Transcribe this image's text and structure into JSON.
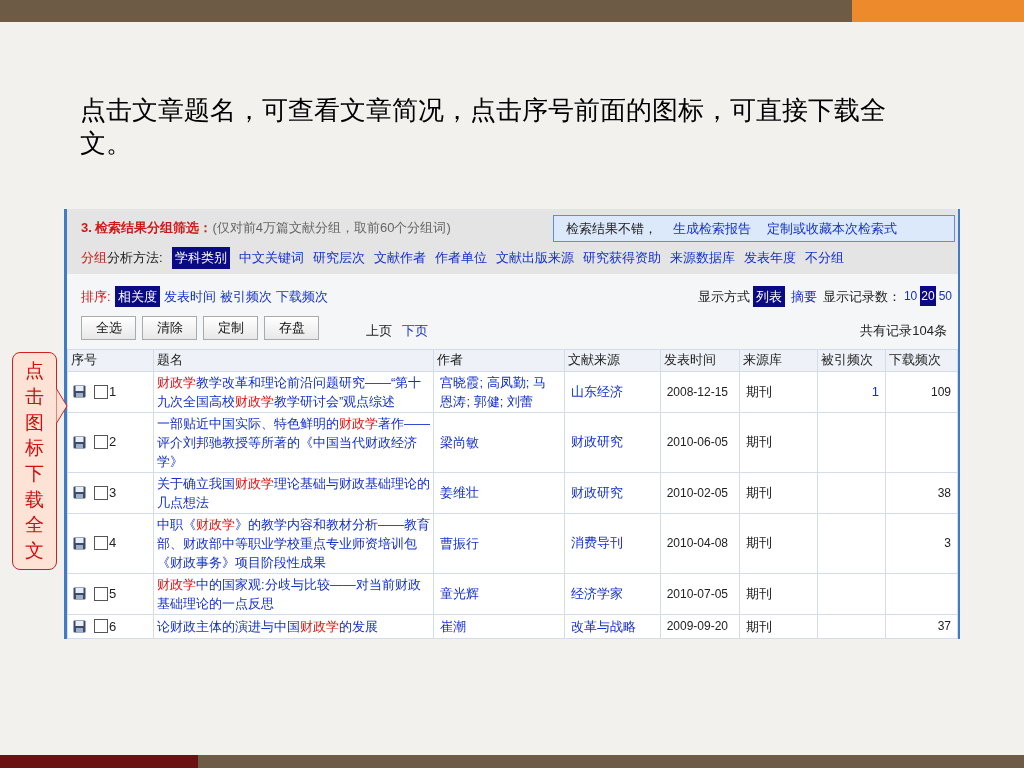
{
  "slide": {
    "text": "点击文章题名，可查看文章简况，点击序号前面的图标，可直接下载全文。",
    "callout": "点击图标下载全文"
  },
  "filter": {
    "heading": "3. 检索结果分组筛选：",
    "note": "(仅对前4万篇文献分组，取前60个分组词)",
    "notice": {
      "text": "检索结果不错，",
      "links": [
        "生成检索报告",
        "定制或收藏本次检索式"
      ]
    },
    "group_label": [
      {
        "text": "分组",
        "highlight": true
      },
      {
        "text": "分析方法:",
        "highlight": false
      }
    ],
    "group_options": [
      {
        "label": "学科类别",
        "selected": true
      },
      {
        "label": "中文关键词",
        "selected": false
      },
      {
        "label": "研究层次",
        "selected": false
      },
      {
        "label": "文献作者",
        "selected": false
      },
      {
        "label": "作者单位",
        "selected": false
      },
      {
        "label": "文献出版来源",
        "selected": false
      },
      {
        "label": "研究获得资助",
        "selected": false
      },
      {
        "label": "来源数据库",
        "selected": false
      },
      {
        "label": "发表年度",
        "selected": false
      },
      {
        "label": "不分组",
        "selected": false
      }
    ]
  },
  "sort": {
    "label": "排序:",
    "options": [
      {
        "label": "相关度",
        "selected": true
      },
      {
        "label": "发表时间",
        "selected": false
      },
      {
        "label": "被引频次",
        "selected": false
      },
      {
        "label": "下载频次",
        "selected": false
      }
    ]
  },
  "display": {
    "label": "显示方式",
    "modes": [
      {
        "label": "列表",
        "selected": true
      },
      {
        "label": "摘要",
        "selected": false
      }
    ],
    "count_label": "显示记录数：",
    "counts": [
      {
        "label": "10",
        "selected": false
      },
      {
        "label": "20",
        "selected": true
      },
      {
        "label": "50",
        "selected": false
      }
    ]
  },
  "buttons": [
    "全选",
    "清除",
    "定制",
    "存盘"
  ],
  "pager": [
    {
      "label": "上页",
      "disabled": true
    },
    {
      "label": "下页",
      "disabled": false
    }
  ],
  "total": "共有记录104条",
  "table": {
    "columns": [
      "序号",
      "题名",
      "作者",
      "文献来源",
      "发表时间",
      "来源库",
      "被引频次",
      "下载频次"
    ],
    "rows": [
      {
        "index": "1",
        "checked": false,
        "title": [
          {
            "text": "财政学",
            "highlight": true
          },
          {
            "text": "教学改革和理论前沿问题研究——“第十九次全国高校",
            "highlight": false
          },
          {
            "text": "财政学",
            "highlight": true
          },
          {
            "text": "教学研讨会”观点综述",
            "highlight": false
          }
        ],
        "author": "宫晓霞; 高凤勤; 马恩涛; 郭健; 刘蕾",
        "source": "山东经济",
        "date": "2008-12-15",
        "db": "期刊",
        "cited": "1",
        "downloads": "109"
      },
      {
        "index": "2",
        "checked": false,
        "title": [
          {
            "text": "一部贴近中国实际、特色鲜明的",
            "highlight": false
          },
          {
            "text": "财政学",
            "highlight": true
          },
          {
            "text": "著作——评介刘邦驰教授等所著的《中国当代财政经济学》",
            "highlight": false
          }
        ],
        "author": "梁尚敏",
        "source": "财政研究",
        "date": "2010-06-05",
        "db": "期刊"
      },
      {
        "index": "3",
        "checked": false,
        "title": [
          {
            "text": "关于确立我国",
            "highlight": false
          },
          {
            "text": "财政学",
            "highlight": true
          },
          {
            "text": "理论基础与财政基础理论的几点想法",
            "highlight": false
          }
        ],
        "author": "姜维壮",
        "source": "财政研究",
        "date": "2010-02-05",
        "db": "期刊",
        "downloads": "38"
      },
      {
        "index": "4",
        "checked": false,
        "title": [
          {
            "text": "中职《",
            "highlight": false
          },
          {
            "text": "财政学",
            "highlight": true
          },
          {
            "text": "》的教学内容和教材分析——教育部、财政部中等职业学校重点专业师资培训包《财政事务》项目阶段性成果",
            "highlight": false
          }
        ],
        "author": "曹振行",
        "source": "消费导刊",
        "date": "2010-04-08",
        "db": "期刊",
        "downloads": "3"
      },
      {
        "index": "5",
        "checked": false,
        "title": [
          {
            "text": "财政学",
            "highlight": true
          },
          {
            "text": "中的国家观:分歧与比较——对当前财政基础理论的一点反思",
            "highlight": false
          }
        ],
        "author": "童光辉",
        "source": "经济学家",
        "date": "2010-07-05",
        "db": "期刊"
      },
      {
        "index": "6",
        "checked": false,
        "title": [
          {
            "text": "论财政主体的演进与中国",
            "highlight": false
          },
          {
            "text": "财政学",
            "highlight": true
          },
          {
            "text": "的发展",
            "highlight": false
          }
        ],
        "author": "崔潮",
        "source": "改革与战略",
        "date": "2009-09-20",
        "db": "期刊",
        "downloads": "37"
      }
    ]
  }
}
